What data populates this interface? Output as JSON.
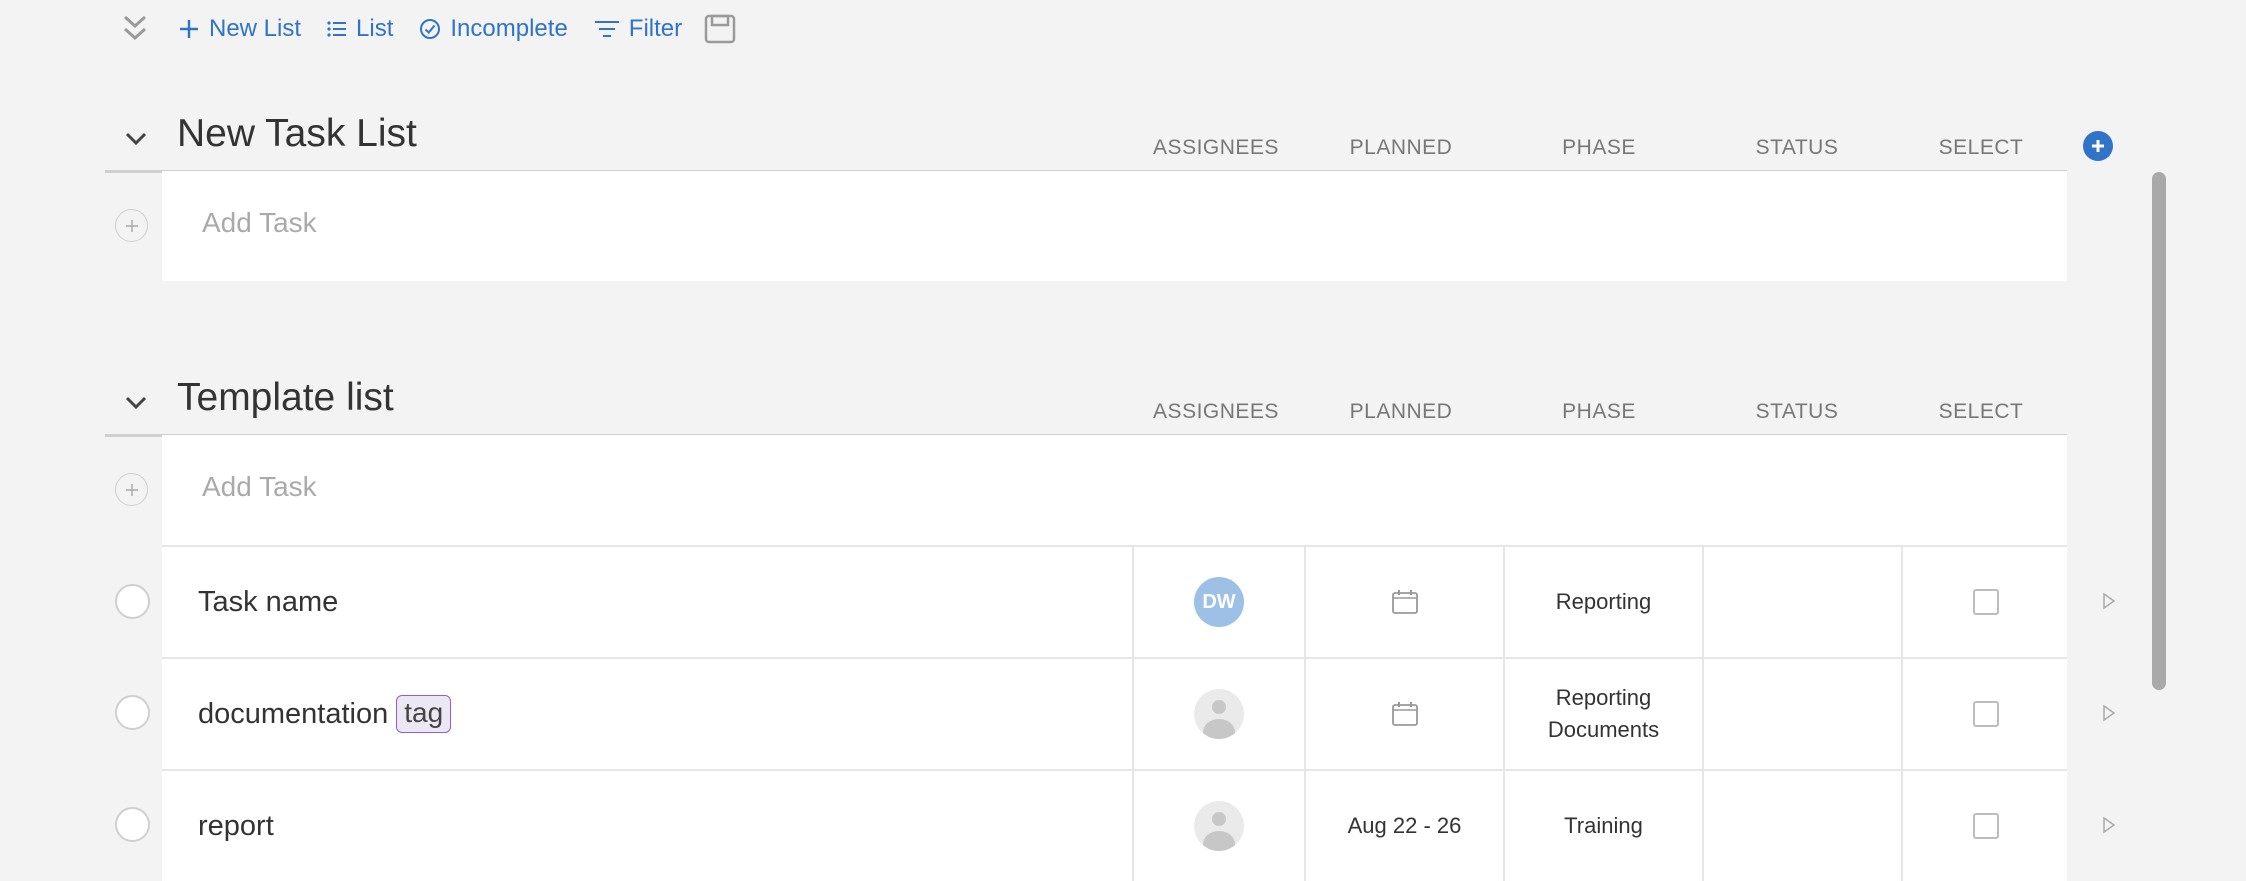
{
  "toolbar": {
    "new_list_label": "New List",
    "list_label": "List",
    "incomplete_label": "Incomplete",
    "filter_label": "Filter"
  },
  "columns": [
    "ASSIGNEES",
    "PLANNED",
    "PHASE",
    "STATUS",
    "SELECT"
  ],
  "lists": [
    {
      "title": "New Task List",
      "add_task_placeholder": "Add Task"
    },
    {
      "title": "Template list",
      "add_task_placeholder": "Add Task",
      "tasks": [
        {
          "name": "Task name",
          "tag": "",
          "assignee_initials": "DW",
          "planned": "",
          "phase": "Reporting",
          "status": ""
        },
        {
          "name": "documentation",
          "tag": "tag",
          "assignee_initials": "",
          "planned": "",
          "phase_line1": "Reporting",
          "phase_line2": "Documents",
          "status": ""
        },
        {
          "name": "report",
          "tag": "",
          "assignee_initials": "",
          "planned": "Aug 22 - 26",
          "phase": "Training",
          "status": ""
        }
      ]
    }
  ],
  "colors": {
    "accent": "#2f74c9",
    "avatar": "#9cc0e6",
    "tag_border": "#9b59c9"
  },
  "icons": [
    "double-chevron-down-icon",
    "plus-icon",
    "list-icon",
    "check-circle-icon",
    "filter-icon",
    "save-icon",
    "chevron-down-icon",
    "calendar-icon",
    "play-arrow-icon",
    "add-circle-icon"
  ]
}
